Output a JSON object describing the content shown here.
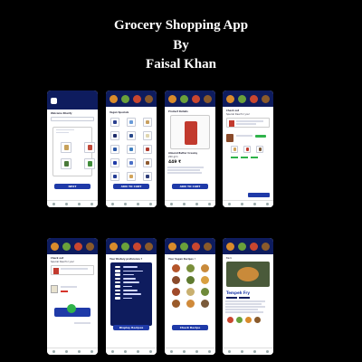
{
  "title": {
    "line1": "Grocery Shopping App",
    "line2": "By",
    "line3": "Faisal Khan"
  },
  "colors": {
    "background": "#000000",
    "brand_navy": "#0e1c5e",
    "button_blue": "#1f3aa8",
    "accent_green": "#2fb34a",
    "accent_red": "#d6342b"
  },
  "screens": {
    "welcome": {
      "header": "Welcome Khanfy",
      "next_button": "NEXT"
    },
    "vegan_specials": {
      "heading": "Vegan Specials",
      "cta": "ADD TO CART"
    },
    "product_details": {
      "heading": "Product Details",
      "product_name": "Almond Butter Creamy",
      "weight": "200 grm",
      "price": "449 ₹",
      "cta": "ADD TO CART"
    },
    "checkout": {
      "heading": "Check out",
      "subheading": "Special Deal for you!"
    },
    "checkout_alt": {
      "heading": "Check out",
      "subheading": "Special Deal for you!"
    },
    "diet_preference": {
      "heading": "Your Dietary preference ?",
      "cta": "Display Recipes"
    },
    "vegan_recipes": {
      "heading": "Your Vegan Recipes !",
      "cta": "Check Recipe"
    },
    "recipe": {
      "heading": "Back",
      "dish": "Tempeh Fry"
    }
  }
}
